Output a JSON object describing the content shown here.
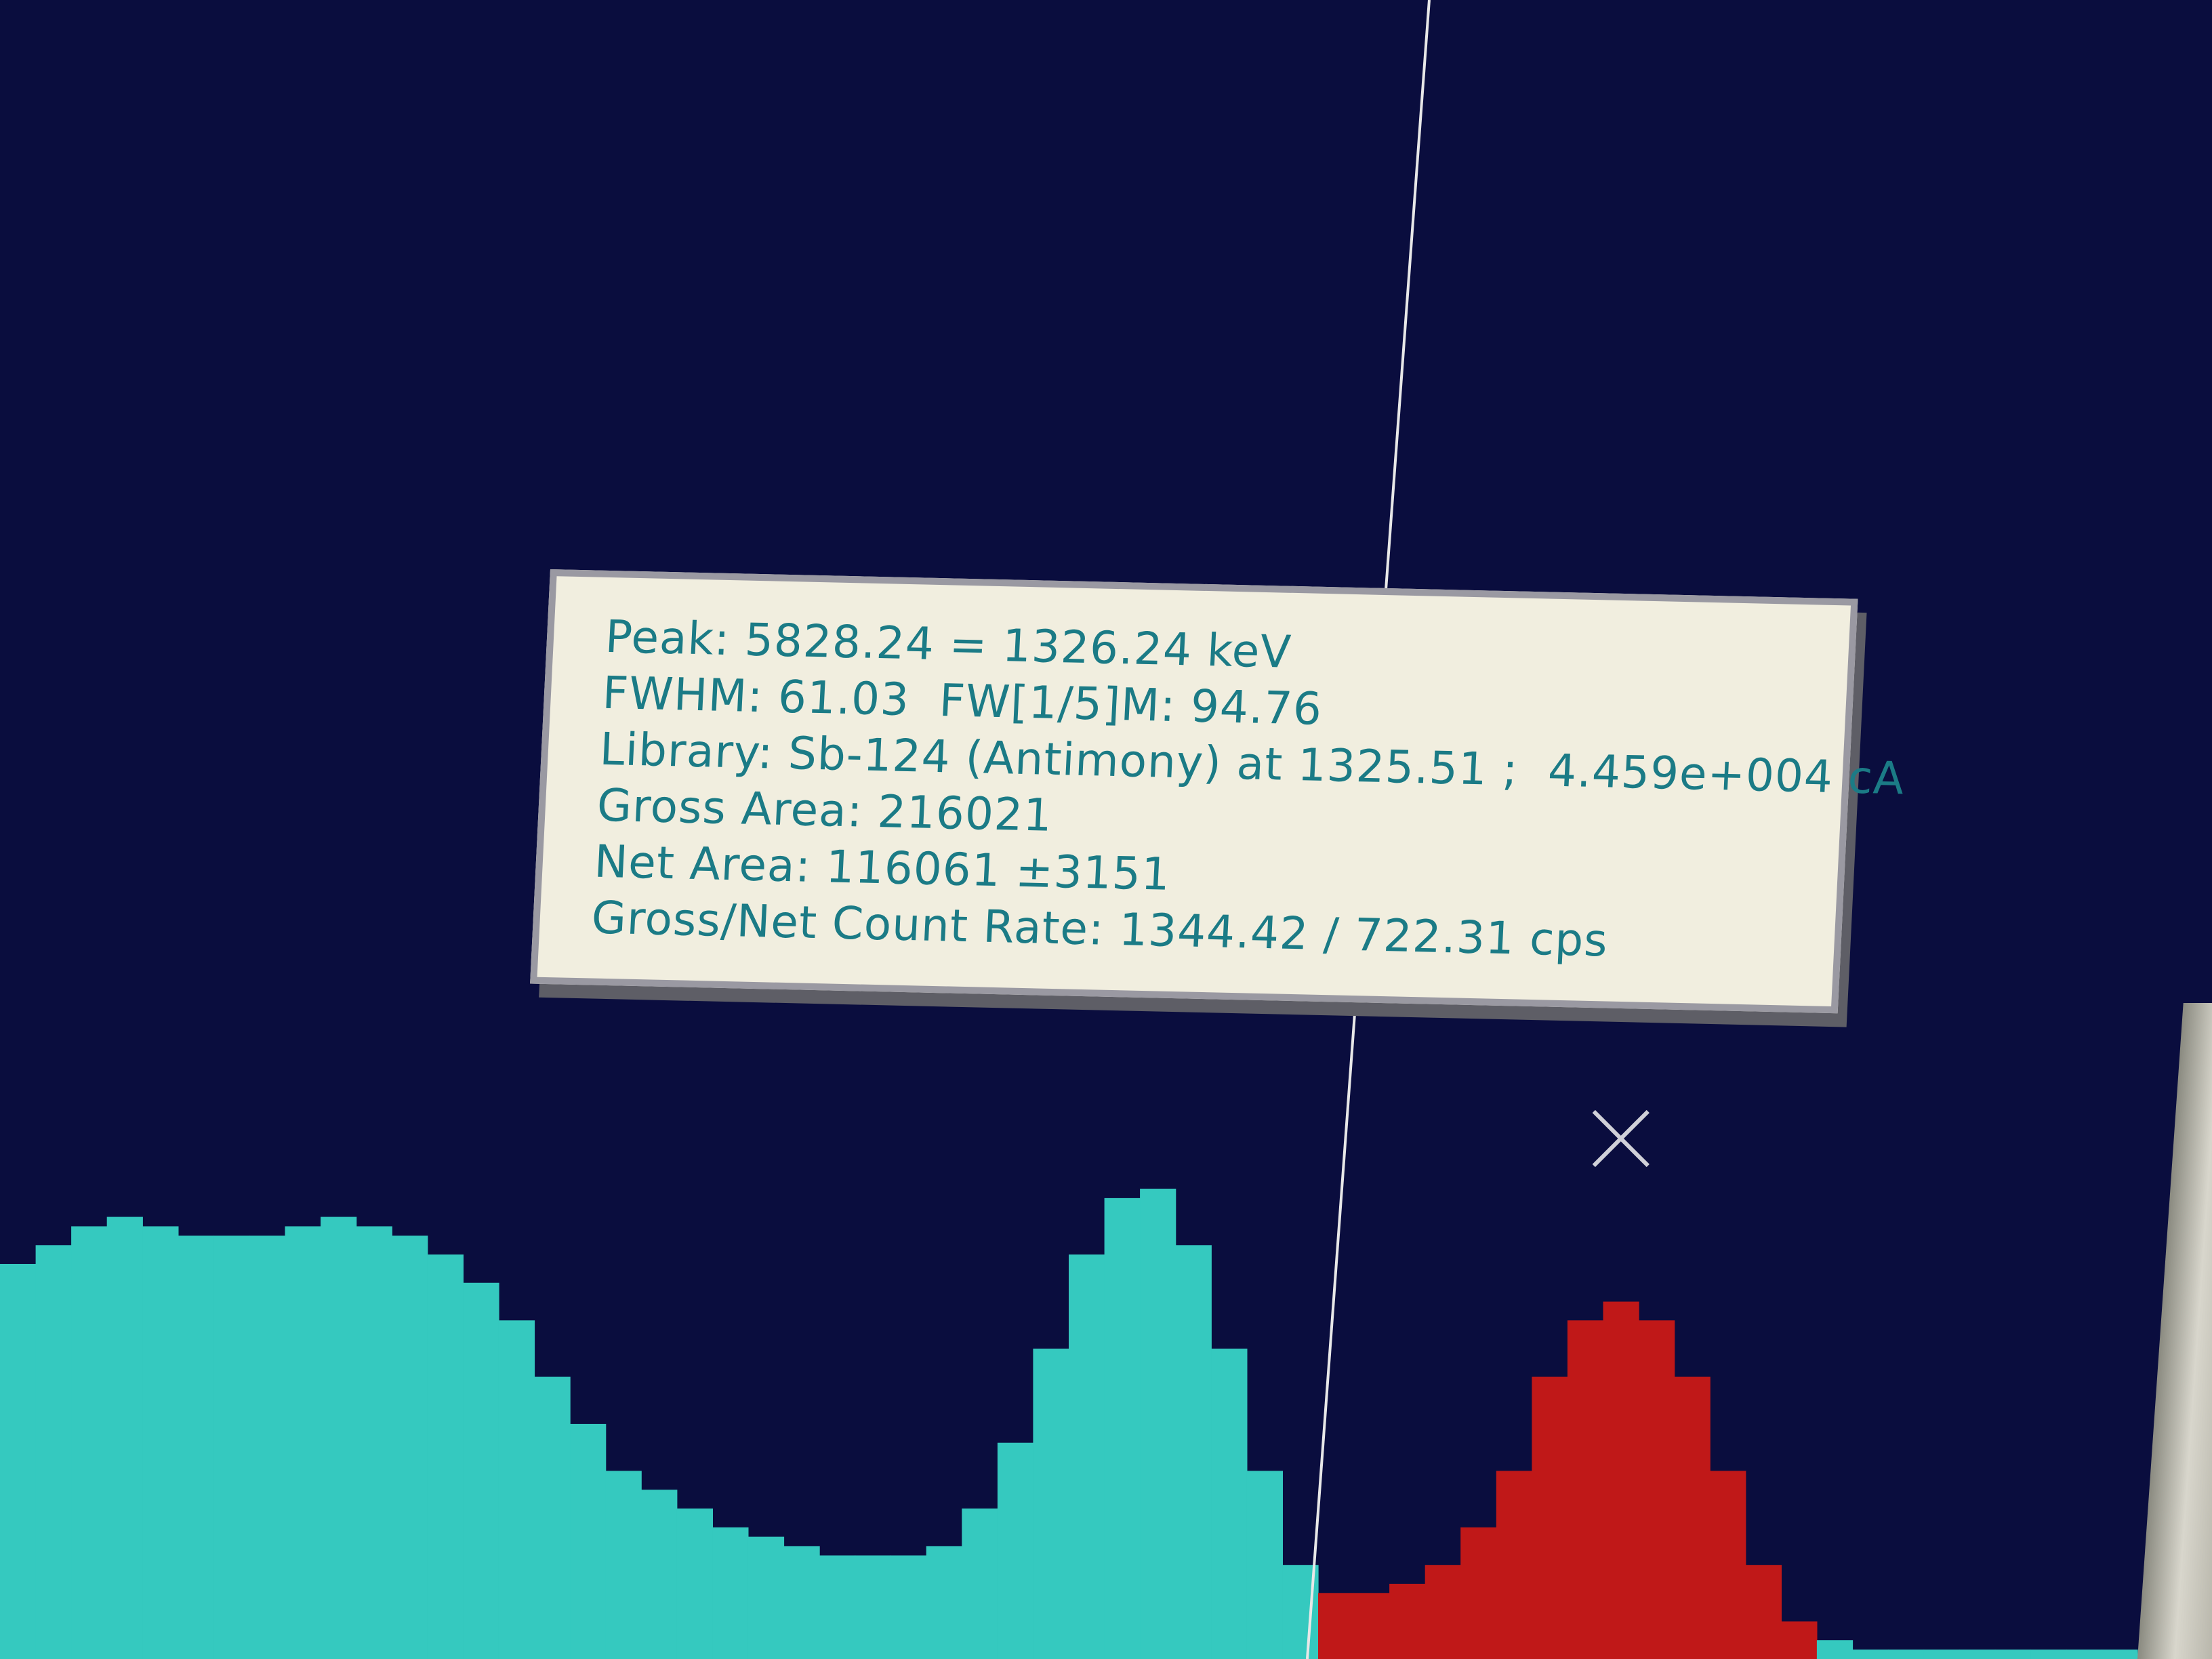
{
  "peak_info": {
    "peak": {
      "label": "Peak:",
      "value": "5828.24 = 1326.24 keV"
    },
    "fwhm": {
      "label": "FWHM:",
      "value": "61.03",
      "fw15_label": "FW[1/5]M:",
      "fw15_value": "94.76"
    },
    "library": {
      "label": "Library:",
      "value": "Sb-124 (Antimony) at 1325.51 ;",
      "activity": "4.459e+004 cA"
    },
    "gross_area": {
      "label": "Gross Area:",
      "value": "216021"
    },
    "net_area": {
      "label": "Net Area:",
      "value": "116061 ±3151"
    },
    "count_rate": {
      "label": "Gross/Net Count Rate:",
      "value": "1344.42 / 722.31 cps"
    }
  },
  "colors": {
    "background": "#0a0d3e",
    "spectrum": "#35c9bf",
    "roi": "#c01818",
    "cursor": "#e8e8e8",
    "tooltip_bg": "#f1eedf",
    "tooltip_text": "#1b7b86"
  },
  "chart_data": {
    "type": "bar",
    "series": [
      {
        "values": [
          0.42,
          0.44,
          0.46,
          0.47,
          0.46,
          0.45,
          0.45,
          0.45,
          0.46,
          0.47,
          0.46,
          0.45,
          0.43,
          0.4,
          0.36,
          0.3,
          0.25,
          0.2,
          0.18,
          0.16,
          0.14,
          0.13,
          0.12,
          0.11,
          0.11,
          0.11,
          0.12,
          0.16,
          0.23,
          0.33,
          0.43,
          0.49,
          0.5,
          0.44,
          0.33,
          0.2,
          0.1,
          0.07,
          0.07,
          0.08,
          0.1,
          0.14,
          0.2,
          0.3,
          0.36,
          0.38,
          0.36,
          0.3,
          0.2,
          0.1,
          0.04,
          0.02,
          0.01,
          0.01,
          0.01,
          0.01,
          0.01,
          0.01,
          0.01,
          0.01
        ]
      }
    ],
    "roi_range": [
      37,
      50
    ],
    "cursor_index": 37,
    "marker_index": 44
  }
}
